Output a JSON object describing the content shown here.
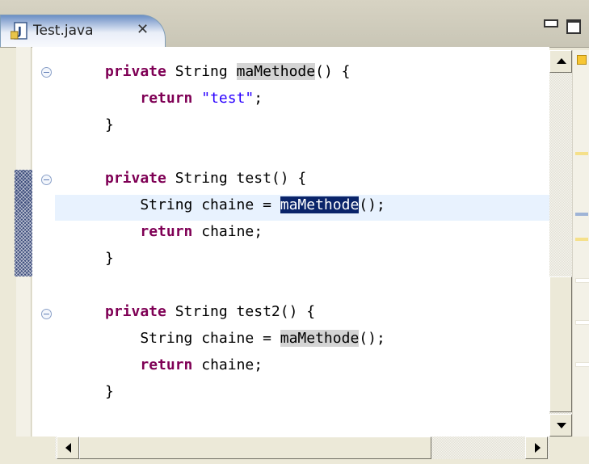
{
  "editor": {
    "tab": {
      "label": "Test.java",
      "icon": "java-file-icon",
      "close_symbol": "✕"
    },
    "view_controls": [
      "minimize-icon",
      "maximize-icon"
    ],
    "code": [
      {
        "line": [
          {
            "t": "private",
            "s": "kw"
          },
          {
            "t": " String ",
            "s": ""
          },
          {
            "t": "maMethode",
            "s": "occ"
          },
          {
            "t": "() {",
            "s": ""
          }
        ]
      },
      {
        "line": [
          {
            "t": "    ",
            "s": ""
          },
          {
            "t": "return",
            "s": "kw"
          },
          {
            "t": " ",
            "s": ""
          },
          {
            "t": "\"test\"",
            "s": "str"
          },
          {
            "t": ";",
            "s": ""
          }
        ]
      },
      {
        "line": [
          {
            "t": "}",
            "s": ""
          }
        ]
      },
      {
        "line": []
      },
      {
        "line": [
          {
            "t": "private",
            "s": "kw"
          },
          {
            "t": " String test() {",
            "s": ""
          }
        ]
      },
      {
        "line": [
          {
            "t": "    String chaine = ",
            "s": ""
          },
          {
            "t": "maMethode",
            "s": "sel"
          },
          {
            "t": "();",
            "s": ""
          }
        ]
      },
      {
        "line": [
          {
            "t": "    ",
            "s": ""
          },
          {
            "t": "return",
            "s": "kw"
          },
          {
            "t": " chaine;",
            "s": ""
          }
        ]
      },
      {
        "line": [
          {
            "t": "}",
            "s": ""
          }
        ]
      },
      {
        "line": []
      },
      {
        "line": [
          {
            "t": "private",
            "s": "kw"
          },
          {
            "t": " String test2() {",
            "s": ""
          }
        ]
      },
      {
        "line": [
          {
            "t": "    String chaine = ",
            "s": ""
          },
          {
            "t": "maMethode",
            "s": "occ"
          },
          {
            "t": "();",
            "s": ""
          }
        ]
      },
      {
        "line": [
          {
            "t": "    ",
            "s": ""
          },
          {
            "t": "return",
            "s": "kw"
          },
          {
            "t": " chaine;",
            "s": ""
          }
        ]
      },
      {
        "line": [
          {
            "t": "}",
            "s": ""
          }
        ]
      }
    ],
    "current_line_index": 5,
    "folded_method_lines": [
      0,
      4,
      9
    ],
    "overview_marks": [
      {
        "color": "#f5e08a",
        "kind": "occurrence-mark"
      },
      {
        "color": "#9fb4d6",
        "kind": "selection-mark"
      },
      {
        "color": "#f5e08a",
        "kind": "occurrence-mark"
      },
      {
        "color": "#ffffff",
        "kind": "line-mark"
      },
      {
        "color": "#ffffff",
        "kind": "line-mark"
      },
      {
        "color": "#ffffff",
        "kind": "line-mark"
      }
    ],
    "colors": {
      "keyword": "#7f0055",
      "string": "#2a00ff",
      "occurrence_highlight": "#d4d4d4",
      "selection": "#0a246a",
      "current_line": "#e8f2fe"
    }
  }
}
